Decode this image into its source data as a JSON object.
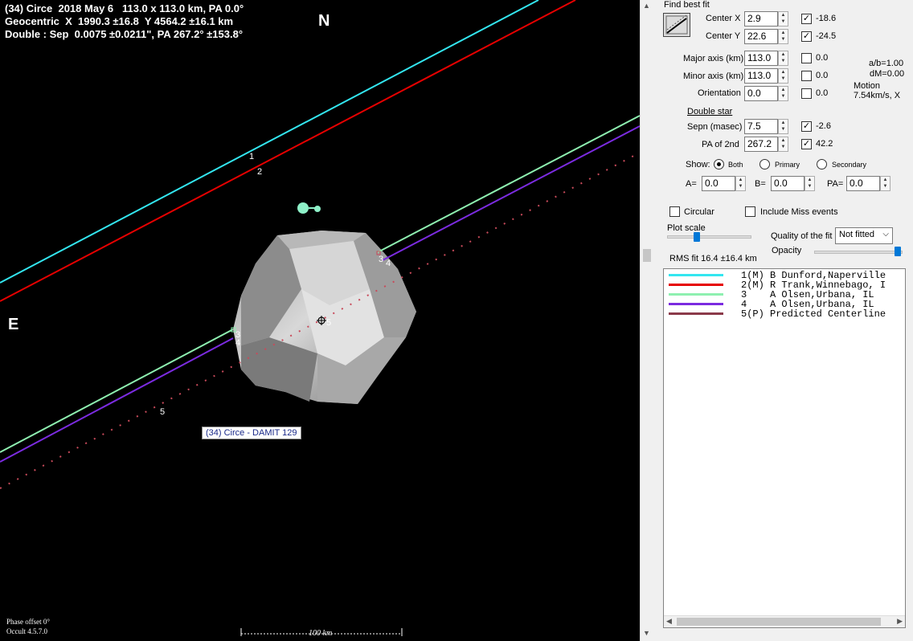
{
  "plot": {
    "header_line1": "(34) Circe  2018 May 6   113.0 x 113.0 km, PA 0.0°",
    "header_line2": "Geocentric  X  1990.3 ±16.8  Y 4564.2 ±16.1 km",
    "header_line3": "Double : Sep  0.0075 ±0.0211\", PA 267.2° ±153.8°",
    "north": "N",
    "east": "E",
    "phase_offset": "Phase offset 0°",
    "version": "Occult 4.5.7.0",
    "shape_label": "(34) Circe - DAMIT 129",
    "scale_label": "100 km",
    "chord_labels": {
      "c1": "1",
      "c2": "2",
      "c3a": "3",
      "c4a": "4",
      "c3b": "3",
      "c4b": "4",
      "c5a": "5",
      "c5b": "5"
    },
    "colors": {
      "c1": "#33e6f0",
      "c2": "#e60000",
      "c3": "#8ef0b0",
      "c4": "#7b2be0",
      "c5": "#c84a5a"
    }
  },
  "panel": {
    "find_best_fit": "Find best fit",
    "center_x": {
      "label": "Center X",
      "value": "2.9",
      "checked": "✓",
      "fit": "-18.6"
    },
    "center_y": {
      "label": "Center Y",
      "value": "22.6",
      "checked": "✓",
      "fit": "-24.5"
    },
    "major_axis": {
      "label": "Major axis (km)",
      "value": "113.0",
      "fit": "0.0"
    },
    "minor_axis": {
      "label": "Minor axis (km)",
      "value": "113.0",
      "fit": "0.0"
    },
    "orientation": {
      "label": "Orientation",
      "value": "0.0",
      "fit": "0.0"
    },
    "ab_ratio": "a/b=1.00",
    "dm": "dM=0.00",
    "motion_label": "Motion",
    "motion_value": "7.54km/s, X",
    "double_star": "Double star",
    "sepn": {
      "label": "Sepn (masec)",
      "value": "7.5",
      "checked": "✓",
      "fit": "-2.6"
    },
    "pa2": {
      "label": "PA of 2nd",
      "value": "267.2",
      "checked": "✓",
      "fit": "42.2"
    },
    "show_label": "Show:",
    "show_options": [
      "Both",
      "Primary",
      "Secondary"
    ],
    "a_label": "A=",
    "a_value": "0.0",
    "b_label": "B=",
    "b_value": "0.0",
    "pa_label": "PA=",
    "pa_value": "0.0",
    "circular": "Circular",
    "include_miss": "Include Miss events",
    "plot_scale": "Plot scale",
    "quality_label": "Quality of the fit",
    "quality_value": "Not fitted",
    "opacity": "Opacity",
    "rms_fit": "RMS fit 16.4 ±16.4 km",
    "chords": [
      {
        "text": "1(M) B Dunford,Naperville",
        "color": "#33e6f0"
      },
      {
        "text": "2(M) R Trank,Winnebago, I",
        "color": "#e60000"
      },
      {
        "text": "3    A Olsen,Urbana, IL",
        "color": "#8ef0b0"
      },
      {
        "text": "4    A Olsen,Urbana, IL",
        "color": "#7b2be0"
      },
      {
        "text": "5(P) Predicted Centerline",
        "color": "#8b3a4a"
      }
    ]
  }
}
